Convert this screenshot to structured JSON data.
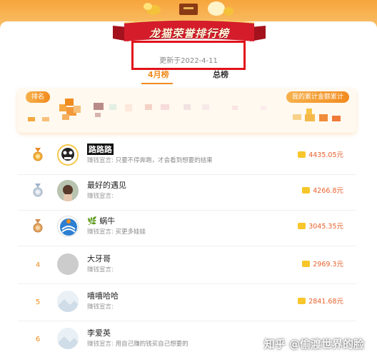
{
  "banner": {
    "title": "龙猫荣誉排行榜"
  },
  "update": {
    "text": "更新于2022-4-11"
  },
  "tabs": {
    "month": "4月榜",
    "total": "总榜"
  },
  "header": {
    "rank_label": "排名",
    "total_label": "我的累计金额累计"
  },
  "rows": [
    {
      "rank": "1",
      "name": "路路路",
      "motto_label": "赚钱宣言:",
      "motto": "只要不停奔跑，才会看到想要的结果",
      "amount": "4435.05元"
    },
    {
      "rank": "2",
      "name": "最好的遇见",
      "motto_label": "赚钱宣言:",
      "motto": "",
      "amount": "4266.8元"
    },
    {
      "rank": "3",
      "name": "🌿 蜗牛",
      "motto_label": "赚钱宣言:",
      "motto": "买更多娃娃",
      "amount": "3045.35元"
    },
    {
      "rank": "4",
      "name": "大牙哥",
      "motto_label": "赚钱宣言:",
      "motto": "",
      "amount": "2969.3元"
    },
    {
      "rank": "5",
      "name": "嘻嘻哈哈",
      "motto_label": "赚钱宣言:",
      "motto": "",
      "amount": "2841.68元"
    },
    {
      "rank": "6",
      "name": "李爱英",
      "motto_label": "赚钱宣言:",
      "motto": "用自己赚的钱买自己想要的",
      "amount": ""
    }
  ],
  "watermark": "知乎 @偷渡世界的脸",
  "colors": {
    "accent": "#f08c1e",
    "highlight": "#e1121b",
    "amount": "#e8612c"
  }
}
